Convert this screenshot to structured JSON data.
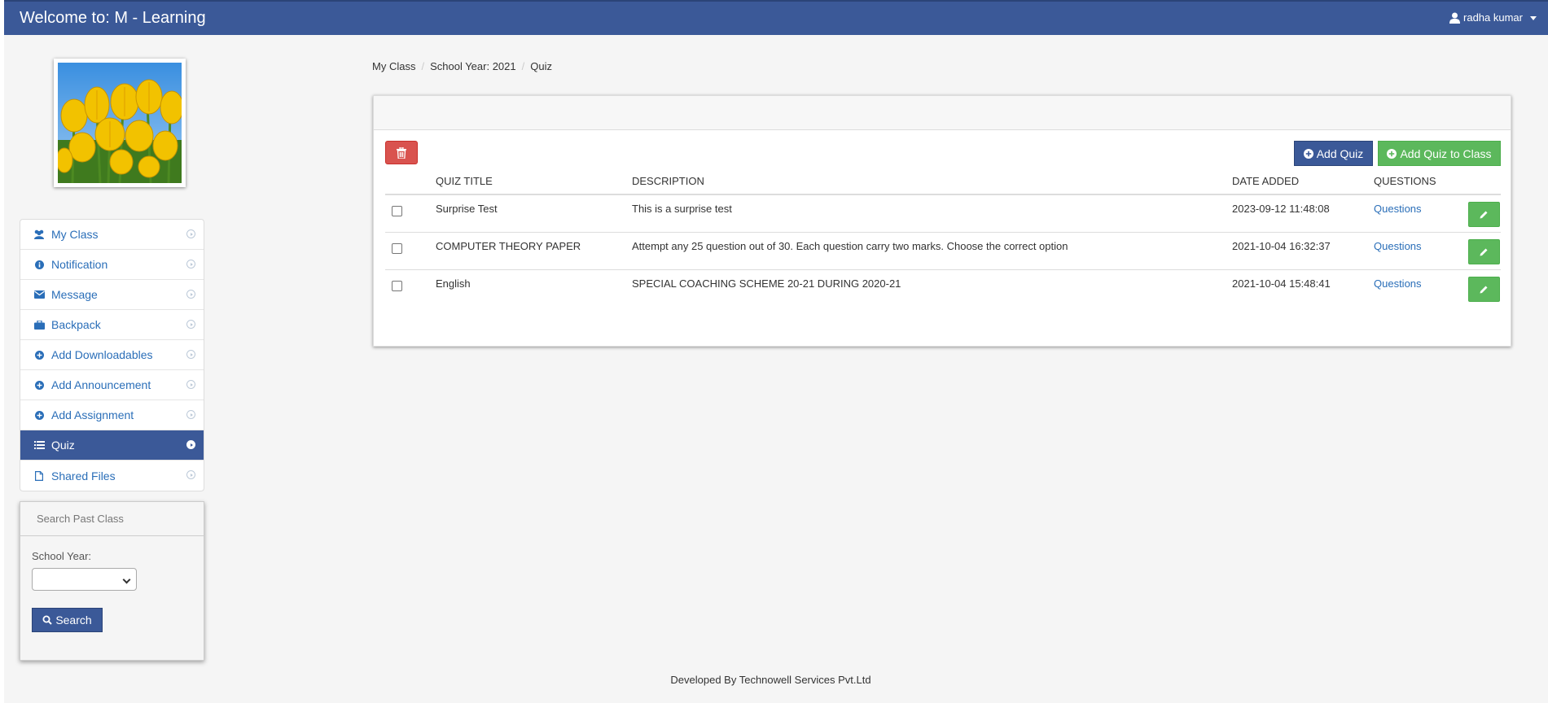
{
  "header": {
    "title": "Welcome to: M - Learning",
    "user_name": "radha kumar"
  },
  "sidebar": {
    "items": [
      {
        "label": "My Class",
        "icon": "users-icon",
        "active": false
      },
      {
        "label": "Notification",
        "icon": "info-icon",
        "active": false
      },
      {
        "label": "Message",
        "icon": "envelope-icon",
        "active": false
      },
      {
        "label": "Backpack",
        "icon": "briefcase-icon",
        "active": false
      },
      {
        "label": "Add Downloadables",
        "icon": "plus-circle-icon",
        "active": false
      },
      {
        "label": "Add Announcement",
        "icon": "plus-circle-icon",
        "active": false
      },
      {
        "label": "Add Assignment",
        "icon": "plus-circle-icon",
        "active": false
      },
      {
        "label": "Quiz",
        "icon": "list-icon",
        "active": true
      },
      {
        "label": "Shared Files",
        "icon": "file-icon",
        "active": false
      }
    ]
  },
  "search_past_class": {
    "heading": "Search Past Class",
    "school_year_label": "School Year:",
    "school_year_value": "",
    "search_button": "Search"
  },
  "breadcrumb": [
    "My Class",
    "School Year: 2021",
    "Quiz"
  ],
  "toolbar": {
    "add_quiz": "Add Quiz",
    "add_quiz_to_class": "Add Quiz to Class"
  },
  "quiz_table": {
    "columns": [
      "QUIZ TITLE",
      "DESCRIPTION",
      "DATE ADDED",
      "QUESTIONS"
    ],
    "rows": [
      {
        "title": "Surprise Test",
        "description": "This is a surprise test",
        "date_added": "2023-09-12 11:48:08",
        "questions": "Questions"
      },
      {
        "title": "COMPUTER THEORY PAPER",
        "description": "Attempt any 25 question out of 30. Each question carry two marks. Choose the correct option",
        "date_added": "2021-10-04 16:32:37",
        "questions": "Questions"
      },
      {
        "title": "English",
        "description": "SPECIAL COACHING SCHEME 20-21 DURING 2020-21",
        "date_added": "2021-10-04 15:48:41",
        "questions": "Questions"
      }
    ]
  },
  "footer": "Developed By Technowell Services Pvt.Ltd",
  "colors": {
    "primary": "#3b5998",
    "success": "#5cb85c",
    "danger": "#d9534f",
    "link": "#2a6eb8"
  }
}
